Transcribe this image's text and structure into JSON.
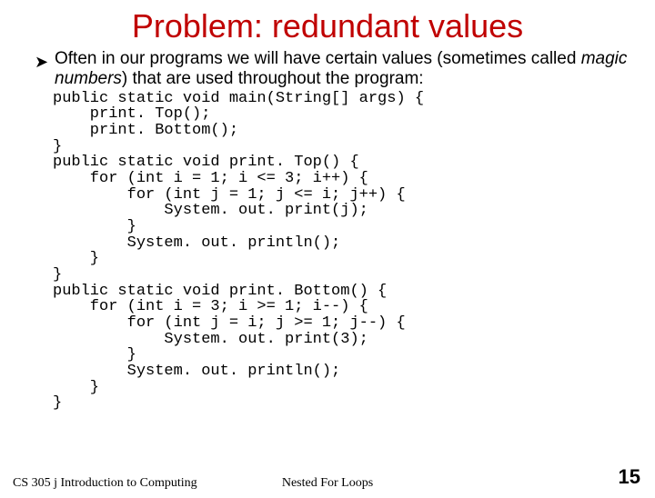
{
  "title": "Problem: redundant values",
  "intro_part1": "Often in our programs we will have certain values (sometimes called ",
  "intro_italic": "magic numbers",
  "intro_part2": ") that are used throughout the program:",
  "code": "public static void main(String[] args) {\n    print. Top();\n    print. Bottom();\n}\npublic static void print. Top() {\n    for (int i = 1; i <= 3; i++) {\n        for (int j = 1; j <= i; j++) {\n            System. out. print(j);\n        }\n        System. out. println();\n    }\n}\npublic static void print. Bottom() {\n    for (int i = 3; i >= 1; i--) {\n        for (int j = i; j >= 1; j--) {\n            System. out. print(3);\n        }\n        System. out. println();\n    }\n}",
  "footer_left": "CS 305 j Introduction to Computing",
  "footer_center": "Nested For Loops",
  "page_number": "15"
}
